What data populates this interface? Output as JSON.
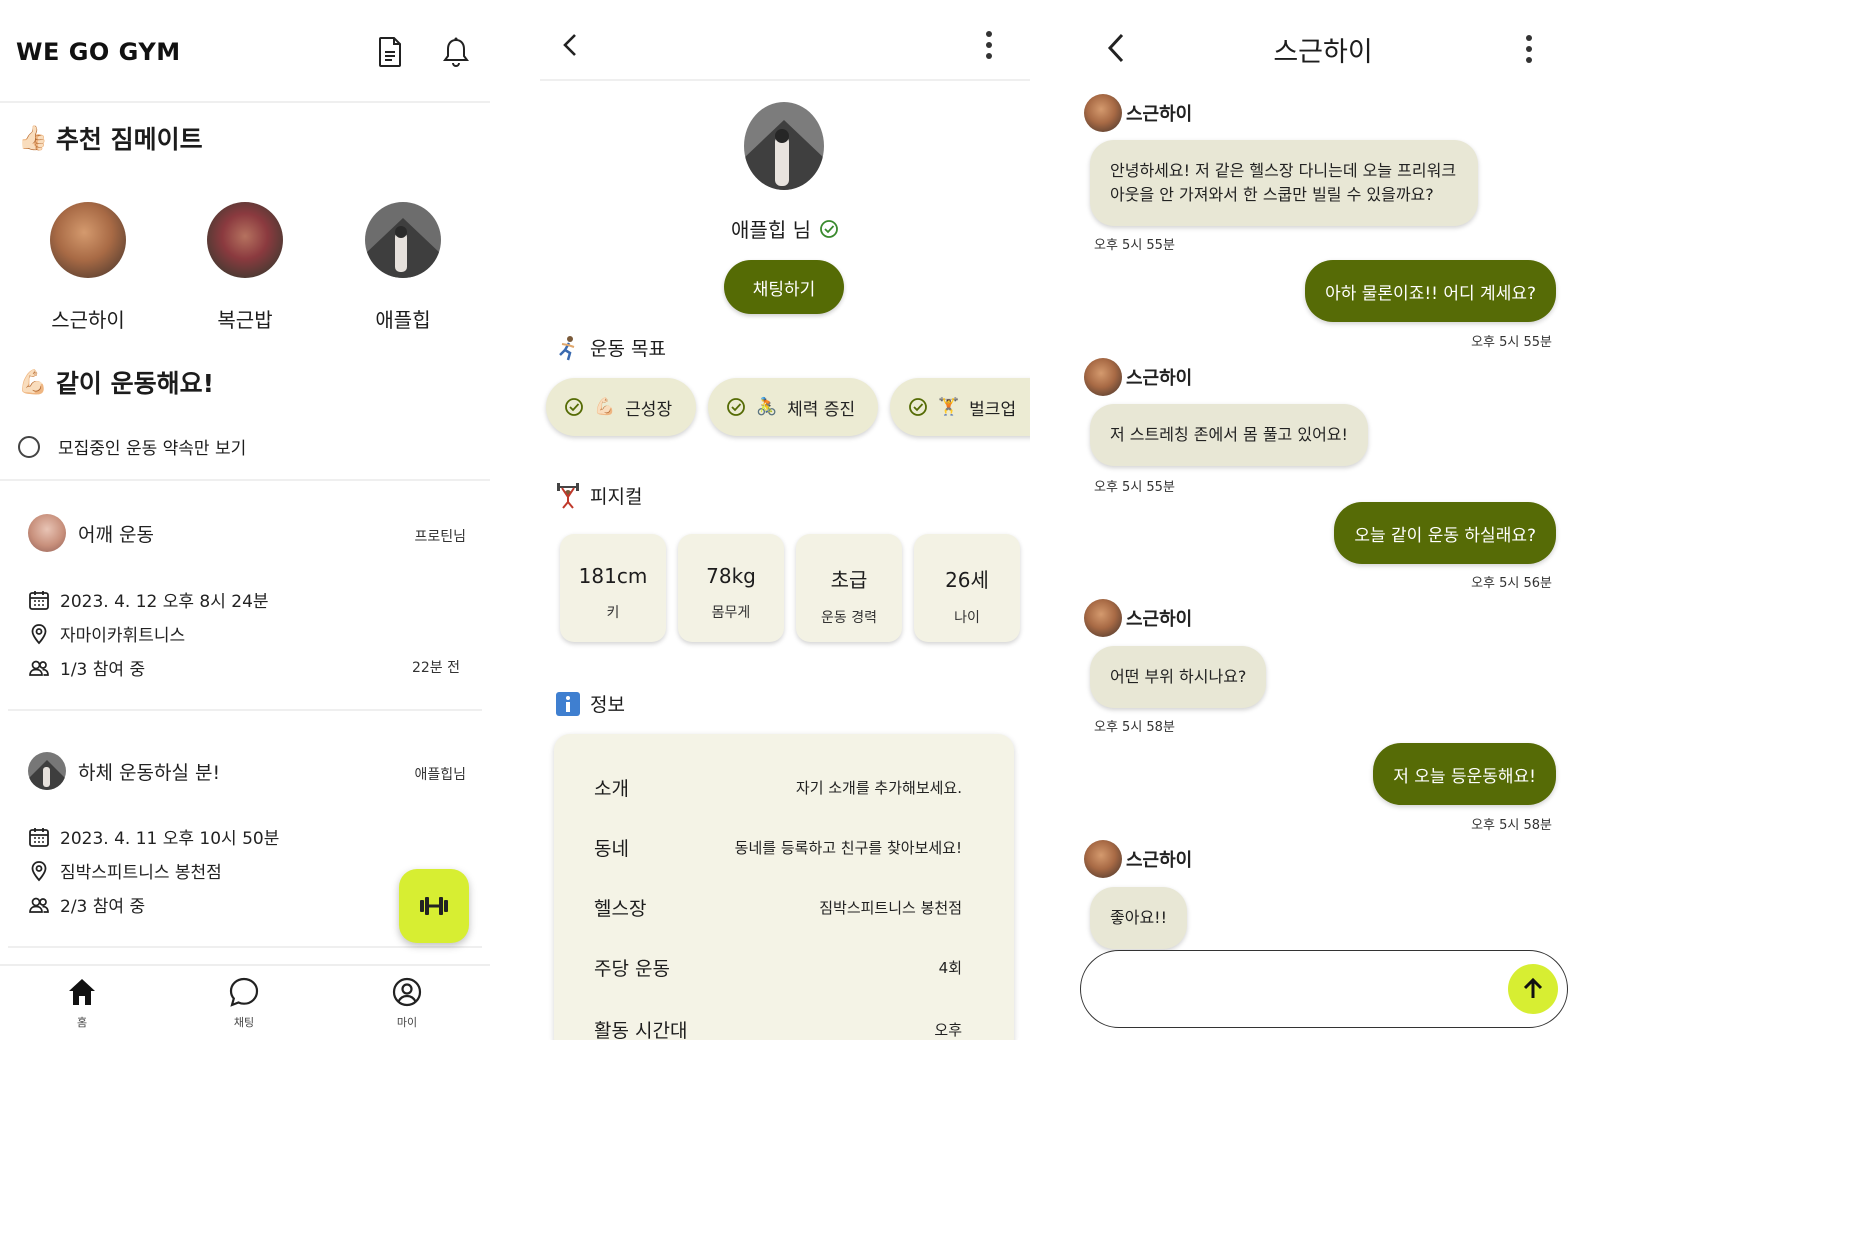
{
  "home": {
    "brand": "WE GO GYM",
    "section_recommend": "추천 짐메이트",
    "recommend_emoji": "👍🏻",
    "mates": [
      {
        "name": "스근하이"
      },
      {
        "name": "복근밥"
      },
      {
        "name": "애플힙"
      }
    ],
    "section_together": "같이 운동해요!",
    "together_emoji": "💪🏻",
    "filter_label": "모집중인 운동 약속만 보기",
    "posts": [
      {
        "title": "어깨 운동",
        "author": "프로틴님",
        "datetime": "2023. 4. 12 오후 8시 24분",
        "place": "자마이카휘트니스",
        "participants": "1/3 참여 중",
        "ago": "22분 전"
      },
      {
        "title": "하체 운동하실 분!",
        "author": "애플힙님",
        "datetime": "2023. 4. 11 오후 10시 50분",
        "place": "짐박스피트니스 봉천점",
        "participants": "2/3 참여 중",
        "ago": ""
      }
    ],
    "nav": [
      {
        "label": "홈",
        "icon": "home-icon"
      },
      {
        "label": "채팅",
        "icon": "chat-icon"
      },
      {
        "label": "마이",
        "icon": "profile-icon"
      }
    ],
    "accent": "#d7ee32"
  },
  "profile": {
    "name": "애플힙 님",
    "chat_button": "채팅하기",
    "goal_title": "운동 목표",
    "goals": [
      {
        "emoji": "💪🏻",
        "label": "근성장"
      },
      {
        "emoji": "🚴",
        "label": "체력 증진"
      },
      {
        "emoji": "🏋️",
        "label": "벌크업"
      }
    ],
    "physical_title": "피지컬",
    "stats": [
      {
        "value": "181cm",
        "label": "키"
      },
      {
        "value": "78kg",
        "label": "몸무게"
      },
      {
        "value": "초급",
        "label": "운동 경력"
      },
      {
        "value": "26세",
        "label": "나이"
      }
    ],
    "info_title": "정보",
    "info": [
      {
        "key": "소개",
        "value": "자기 소개를 추가해보세요."
      },
      {
        "key": "동네",
        "value": "동네를 등록하고 친구를 찾아보세요!"
      },
      {
        "key": "헬스장",
        "value": "짐박스피트니스 봉천점"
      },
      {
        "key": "주당 운동",
        "value": "4회"
      },
      {
        "key": "활동 시간대",
        "value": "오후"
      }
    ],
    "button_color": "#556b05"
  },
  "chat": {
    "title": "스근하이",
    "messages": [
      {
        "from": "in",
        "sender": "스근하이",
        "text_lines": [
          "안녕하세요! 저 같은 헬스장 다니는데 오늘 프리워크",
          "아웃을 안 가져와서 한 스쿱만 빌릴 수 있을까요?"
        ],
        "time": "오후 5시 55분"
      },
      {
        "from": "out",
        "text": "아하 물론이죠!! 어디 계세요?",
        "time": "오후 5시 55분"
      },
      {
        "from": "in",
        "sender": "스근하이",
        "text": "저 스트레칭 존에서 몸 풀고 있어요!",
        "time": "오후 5시 55분"
      },
      {
        "from": "out",
        "text": "오늘 같이 운동 하실래요?",
        "time": "오후 5시 56분"
      },
      {
        "from": "in",
        "sender": "스근하이",
        "text": "어떤 부위 하시나요?",
        "time": "오후 5시 58분"
      },
      {
        "from": "out",
        "text": "저 오늘 등운동해요!",
        "time": "오후 5시 58분"
      },
      {
        "from": "in",
        "sender": "스근하이",
        "text": "좋아요!!",
        "time": ""
      }
    ],
    "input_value": "",
    "bubble_out_color": "#566b06",
    "bubble_in_color": "#e8e7d5"
  }
}
